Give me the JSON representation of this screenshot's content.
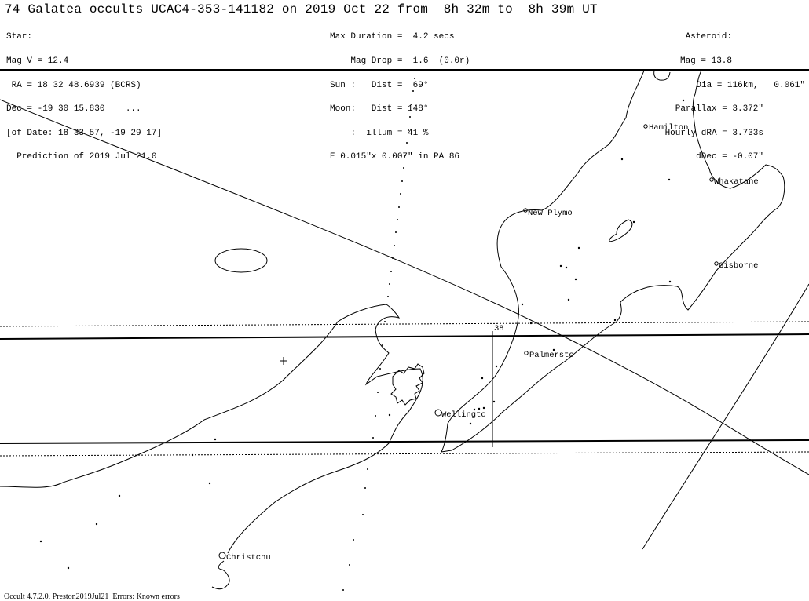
{
  "title": "74 Galatea occults UCAC4-353-141182 on 2019 Oct 22 from  8h 32m to  8h 39m UT",
  "star": {
    "heading": "Star:",
    "mag_v": "Mag V = 12.4",
    "ra": " RA = 18 32 48.6939 (BCRS)",
    "dec": "Dec = -19 30 15.830    ...",
    "of_date": "[of Date: 18 33 57, -19 29 17]",
    "prediction": "  Prediction of 2019 Jul 21.0"
  },
  "event": {
    "max_duration": "Max Duration =  4.2 secs",
    "mag_drop": "    Mag Drop =  1.6  (0.0r)",
    "sun": "Sun :   Dist =  69°",
    "moon": "Moon:   Dist = 148°",
    "illum": "    :  illum = 41 %",
    "error_ellipse": "E 0.015\"x 0.007\" in PA 86"
  },
  "asteroid": {
    "heading": "Asteroid:",
    "mag": "Mag = 13.8",
    "dia": "Dia = 116km,   0.061\"",
    "parallax": "Parallax = 3.372\"",
    "hourly_dra": "Hourly dRA = 3.733s",
    "ddec": "dDec = -0.07\""
  },
  "map": {
    "path_time_label": "38",
    "cities": [
      {
        "name": "Hamilton"
      },
      {
        "name": "Whakatane"
      },
      {
        "name": "New Plymo"
      },
      {
        "name": "Gisborne"
      },
      {
        "name": "Palmersto"
      },
      {
        "name": "Wellingto"
      },
      {
        "name": "Christchu"
      }
    ]
  },
  "footer": "Occult 4.7.2.0, Preston2019Jul21  Errors: Known errors"
}
